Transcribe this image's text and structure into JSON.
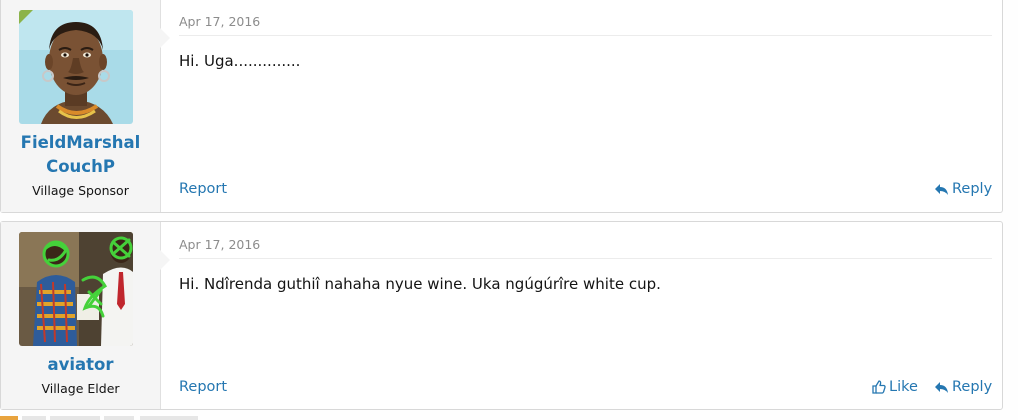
{
  "colors": {
    "link": "#2577b1",
    "date": "#8c8c8c",
    "accent_corner": "#8cb34a",
    "user_cell_bg": "#f5f5f5"
  },
  "posts": [
    {
      "date": "Apr 17, 2016",
      "message": "Hi. Uga..............",
      "username_line1": "FieldMarshal",
      "username_line2": "CouchP",
      "user_title": "Village Sponsor",
      "avatar_icon": "illustrated-portrait-avatar",
      "avatar_caption": "",
      "report_label": "Report",
      "reply_label": "Reply",
      "reply_icon": "reply-arrow-icon"
    },
    {
      "date": "Apr 17, 2016",
      "message": "Hi. Ndîrenda guthiî nahaha nyue wine. Uka ngúgúrîre white cup.",
      "username": "aviator",
      "user_title": "Village Elder",
      "avatar_icon": "photo-avatar-with-green-scribbles",
      "report_label": "Report",
      "like_label": "Like",
      "like_icon": "thumbs-up-icon",
      "reply_label": "Reply",
      "reply_icon": "reply-arrow-icon"
    }
  ]
}
